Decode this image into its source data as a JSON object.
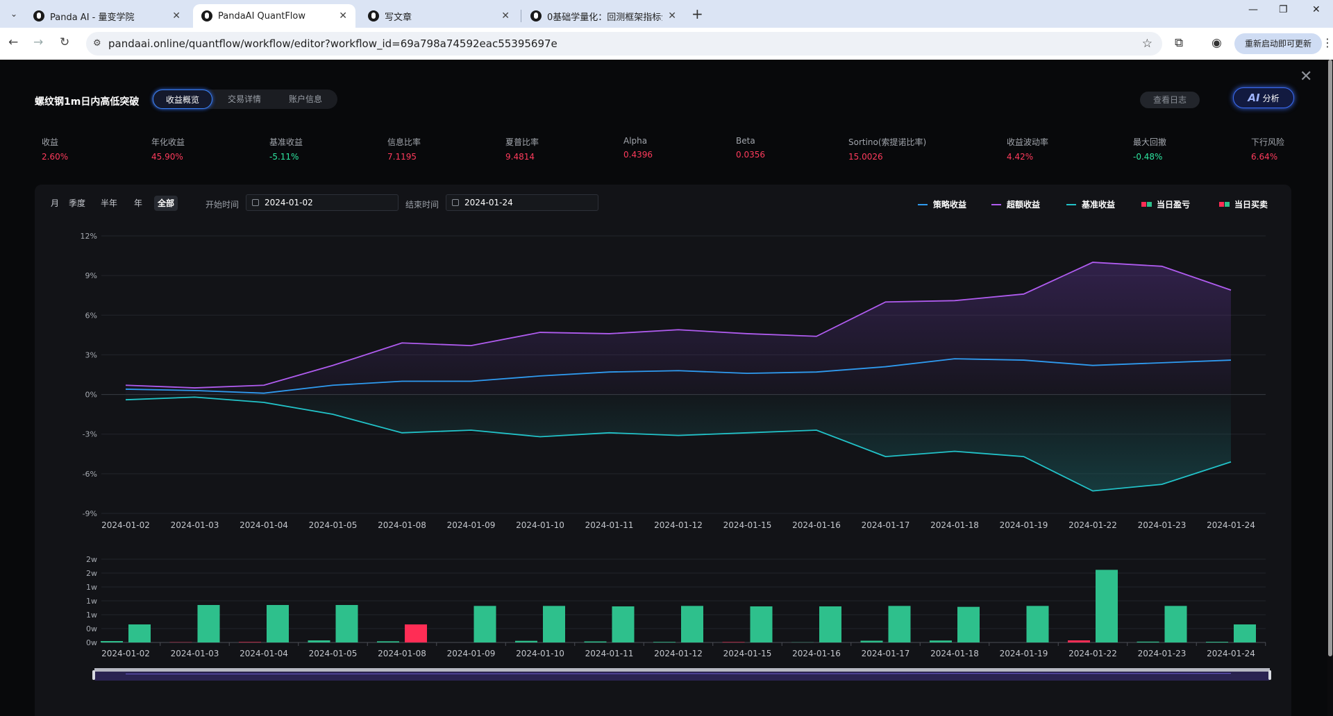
{
  "browser": {
    "tabs": [
      {
        "label": "Panda AI - 量变学院",
        "active": false
      },
      {
        "label": "PandaAI QuantFlow",
        "active": true
      },
      {
        "label": "写文章",
        "active": false
      },
      {
        "label": "0基础学量化：回测框架指标介绍",
        "active": false
      }
    ],
    "url": "pandaai.online/quantflow/workflow/editor?workflow_id=69a798a74592eac55395697e",
    "update_button": "重新启动即可更新"
  },
  "header": {
    "title": "螺纹钢1m日内高低突破",
    "tabs": [
      {
        "label": "收益概览",
        "active": true
      },
      {
        "label": "交易详情",
        "active": false
      },
      {
        "label": "账户信息",
        "active": false
      }
    ],
    "log_button": "查看日志",
    "ai_button_prefix": "AI",
    "ai_button_label": "分析"
  },
  "metrics": [
    {
      "label": "收益",
      "value": "2.60%",
      "color": "red"
    },
    {
      "label": "年化收益",
      "value": "45.90%",
      "color": "red"
    },
    {
      "label": "基准收益",
      "value": "-5.11%",
      "color": "green"
    },
    {
      "label": "信息比率",
      "value": "7.1195",
      "color": "red"
    },
    {
      "label": "夏普比率",
      "value": "9.4814",
      "color": "red"
    },
    {
      "label": "Alpha",
      "value": "0.4396",
      "color": "red"
    },
    {
      "label": "Beta",
      "value": "0.0356",
      "color": "red"
    },
    {
      "label": "Sortino(索提诺比率)",
      "value": "15.0026",
      "color": "red"
    },
    {
      "label": "收益波动率",
      "value": "4.42%",
      "color": "red"
    },
    {
      "label": "最大回撤",
      "value": "-0.48%",
      "color": "green"
    },
    {
      "label": "下行风险",
      "value": "6.64%",
      "color": "red"
    }
  ],
  "controls": {
    "periods": [
      {
        "label": "月",
        "active": false
      },
      {
        "label": "季度",
        "active": false
      },
      {
        "label": "半年",
        "active": false
      },
      {
        "label": "年",
        "active": false
      },
      {
        "label": "全部",
        "active": true
      }
    ],
    "start_label": "开始时间",
    "start_value": "2024-01-02",
    "end_label": "结束时间",
    "end_value": "2024-01-24"
  },
  "legend": [
    {
      "label": "策略收益",
      "type": "line",
      "color": "#2f9bf0"
    },
    {
      "label": "超额收益",
      "type": "line",
      "color": "#b05cf0"
    },
    {
      "label": "基准收益",
      "type": "line",
      "color": "#22c3c9"
    },
    {
      "label": "当日盈亏",
      "type": "bar",
      "colors": [
        "#ff2d55",
        "#2ec08c"
      ]
    },
    {
      "label": "当日买卖",
      "type": "bar",
      "colors": [
        "#ff2d55",
        "#2ec08c"
      ]
    }
  ],
  "chart_data": [
    {
      "type": "line",
      "x": [
        "2024-01-02",
        "2024-01-03",
        "2024-01-04",
        "2024-01-05",
        "2024-01-08",
        "2024-01-09",
        "2024-01-10",
        "2024-01-11",
        "2024-01-12",
        "2024-01-15",
        "2024-01-16",
        "2024-01-17",
        "2024-01-18",
        "2024-01-19",
        "2024-01-22",
        "2024-01-23",
        "2024-01-24"
      ],
      "y_ticks": [
        "12%",
        "9%",
        "6%",
        "3%",
        "0%",
        "-3%",
        "-6%",
        "-9%"
      ],
      "ylim": [
        -9,
        12
      ],
      "series": [
        {
          "name": "策略收益",
          "color": "#2f9bf0",
          "values": [
            0.4,
            0.3,
            0.1,
            0.7,
            1.0,
            1.0,
            1.4,
            1.7,
            1.8,
            1.6,
            1.7,
            2.1,
            2.7,
            2.6,
            2.2,
            2.4,
            2.6
          ]
        },
        {
          "name": "超额收益",
          "color": "#b05cf0",
          "values": [
            0.7,
            0.5,
            0.7,
            2.2,
            3.9,
            3.7,
            4.7,
            4.6,
            4.9,
            4.6,
            4.4,
            7.0,
            7.1,
            7.6,
            10.0,
            9.7,
            7.9
          ]
        },
        {
          "name": "基准收益",
          "color": "#22c3c9",
          "values": [
            -0.4,
            -0.2,
            -0.6,
            -1.5,
            -2.9,
            -2.7,
            -3.2,
            -2.9,
            -3.1,
            -2.9,
            -2.7,
            -4.7,
            -4.3,
            -4.7,
            -7.3,
            -6.8,
            -5.1
          ]
        }
      ]
    },
    {
      "type": "bar",
      "x": [
        "2024-01-02",
        "2024-01-03",
        "2024-01-04",
        "2024-01-05",
        "2024-01-08",
        "2024-01-09",
        "2024-01-10",
        "2024-01-11",
        "2024-01-12",
        "2024-01-15",
        "2024-01-16",
        "2024-01-17",
        "2024-01-18",
        "2024-01-19",
        "2024-01-22",
        "2024-01-23",
        "2024-01-24"
      ],
      "y_ticks": [
        "2w",
        "2w",
        "1w",
        "1w",
        "1w",
        "0w",
        "0w"
      ],
      "ylim": [
        0,
        18000
      ],
      "series": [
        {
          "name": "当日盈亏",
          "values": [
            300,
            60,
            100,
            450,
            250,
            0,
            350,
            220,
            120,
            90,
            40,
            380,
            420,
            0,
            450,
            180,
            150
          ],
          "signs": [
            1,
            -1,
            -1,
            1,
            1,
            0,
            1,
            1,
            1,
            -1,
            1,
            1,
            1,
            0,
            -1,
            1,
            1
          ]
        },
        {
          "name": "当日买卖",
          "values": [
            3900,
            8100,
            8100,
            8100,
            3900,
            7900,
            7900,
            7800,
            7900,
            7800,
            7800,
            7900,
            7700,
            7900,
            15700,
            7900,
            3900
          ],
          "signs": [
            1,
            1,
            1,
            1,
            -1,
            1,
            1,
            1,
            1,
            1,
            1,
            1,
            1,
            1,
            1,
            1,
            1
          ]
        }
      ]
    }
  ]
}
